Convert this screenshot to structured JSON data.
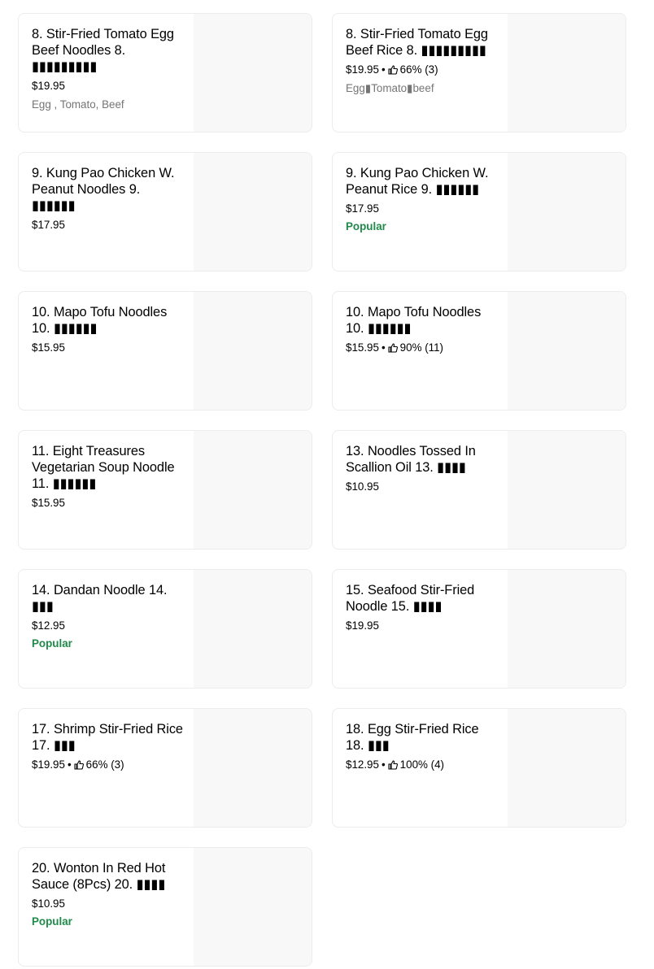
{
  "colors": {
    "popular": "#1f8a4a",
    "muted_text": "#757575",
    "card_border": "#ececec",
    "thumb_bg": "#f8f8f8"
  },
  "menu_items": [
    {
      "name": "8. Stir-Fried Tomato Egg Beef Noodles 8. ▮▮▮▮▮▮▮▮▮",
      "price": "$19.95",
      "rating": "",
      "description": "Egg , Tomato, Beef",
      "badge": ""
    },
    {
      "name": "8. Stir-Fried Tomato Egg Beef Rice 8. ▮▮▮▮▮▮▮▮▮",
      "price": "$19.95",
      "rating": "66% (3)",
      "description": "Egg▮Tomato▮beef",
      "badge": ""
    },
    {
      "name": "9. Kung Pao Chicken W. Peanut Noodles 9. ▮▮▮▮▮▮",
      "price": "$17.95",
      "rating": "",
      "description": "",
      "badge": ""
    },
    {
      "name": "9. Kung Pao Chicken W. Peanut Rice 9. ▮▮▮▮▮▮",
      "price": "$17.95",
      "rating": "",
      "description": "",
      "badge": "Popular"
    },
    {
      "name": "10. Mapo Tofu Noodles 10. ▮▮▮▮▮▮",
      "price": "$15.95",
      "rating": "",
      "description": "",
      "badge": ""
    },
    {
      "name": "10. Mapo Tofu Noodles 10. ▮▮▮▮▮▮",
      "price": "$15.95",
      "rating": "90% (11)",
      "description": "",
      "badge": ""
    },
    {
      "name": "11. Eight Treasures Vegetarian Soup Noodle 11. ▮▮▮▮▮▮",
      "price": "$15.95",
      "rating": "",
      "description": "",
      "badge": ""
    },
    {
      "name": "13. Noodles Tossed In Scallion Oil 13. ▮▮▮▮",
      "price": "$10.95",
      "rating": "",
      "description": "",
      "badge": ""
    },
    {
      "name": "14. Dandan Noodle 14. ▮▮▮",
      "price": "$12.95",
      "rating": "",
      "description": "",
      "badge": "Popular"
    },
    {
      "name": "15. Seafood Stir-Fried Noodle 15. ▮▮▮▮",
      "price": "$19.95",
      "rating": "",
      "description": "",
      "badge": ""
    },
    {
      "name": "17. Shrimp Stir-Fried Rice 17. ▮▮▮",
      "price": "$19.95",
      "rating": "66% (3)",
      "description": "",
      "badge": ""
    },
    {
      "name": "18. Egg Stir-Fried Rice 18. ▮▮▮",
      "price": "$12.95",
      "rating": "100% (4)",
      "description": "",
      "badge": ""
    },
    {
      "name": "20. Wonton In Red Hot Sauce (8Pcs) 20. ▮▮▮▮",
      "price": "$10.95",
      "rating": "",
      "description": "",
      "badge": "Popular"
    }
  ]
}
